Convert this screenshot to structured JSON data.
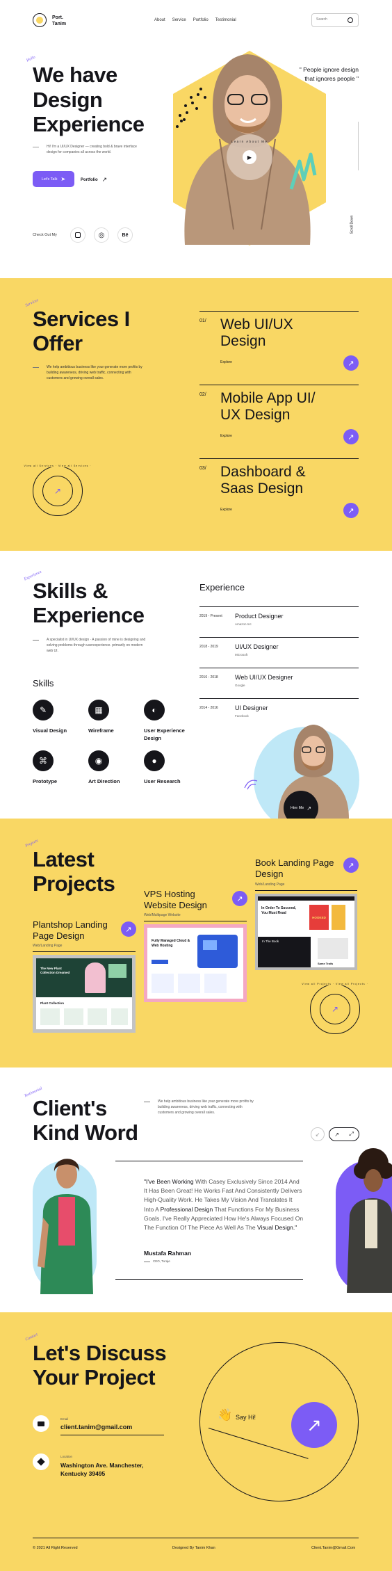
{
  "nav": {
    "brand_line1": "Port.",
    "brand_line2": "Tanim",
    "links": [
      "About",
      "Service",
      "Portfolio",
      "Testimonial"
    ],
    "search_placeholder": "Search"
  },
  "hero": {
    "title_line1": "We have",
    "title_line2": "Design",
    "title_line3": "Experience",
    "desc": "Hi! I'm a UI/UX Designer — creating bold & brave interface design for companies all across the world.",
    "lets_talk": "Let's Talk",
    "portfolio": "Portfolio",
    "quote_line1": "\" People ignore design",
    "quote_line2": "that ignores people \"",
    "badge_text": "Learn About Me",
    "check_out": "Check Out My",
    "social": [
      "instagram-icon",
      "dribbble-icon",
      "behance-icon"
    ],
    "behance_label": "Bē",
    "vertical_label": "Scroll Down"
  },
  "services": {
    "tag": "Services",
    "title_line1": "Services I",
    "title_line2": "Offer",
    "desc": "We help ambitious business like your generate more profits by building awareness, driving web traffic, connecting with customers and growing overall sales.",
    "badge": "View all Services · View all Services ·",
    "items": [
      {
        "num": "01/",
        "line1": "Web UI/UX",
        "line2": "Design",
        "explore": "Explore"
      },
      {
        "num": "02/",
        "line1": "Mobile App UI/",
        "line2": "UX Design",
        "explore": "Explore"
      },
      {
        "num": "03/",
        "line1": "Dashboard &",
        "line2": "Saas Design",
        "explore": "Explore"
      }
    ]
  },
  "skills": {
    "tag": "Experience",
    "title_line1": "Skills &",
    "title_line2": "Experience",
    "desc": "A specialist in UI/UX design  ·  A passion of mine is designing and solving problems through userexperience.  primarily on modern web UI.",
    "skills_heading": "Skills",
    "items": [
      {
        "label": "Visual Design",
        "icon": "pen-tool-icon",
        "glyph": "✎"
      },
      {
        "label": "Wireframe",
        "icon": "wireframe-icon",
        "glyph": "▦"
      },
      {
        "label": "User Experience",
        "label2": "Design",
        "icon": "ux-icon",
        "glyph": "◐"
      },
      {
        "label": "Prototype",
        "icon": "prototype-icon",
        "glyph": "⌘"
      },
      {
        "label": "Art Direction",
        "icon": "art-direction-icon",
        "glyph": "◉"
      },
      {
        "label": "User Research",
        "icon": "user-icon",
        "glyph": "●"
      }
    ],
    "experience_heading": "Experience",
    "experience": [
      {
        "date": "2019 - Present",
        "title": "Product Designer",
        "company": "Amazon Inc"
      },
      {
        "date": "2018 - 2019",
        "title": "UI/UX Designer",
        "company": "Microsoft"
      },
      {
        "date": "2016 - 2018",
        "title": "Web UI/UX Designer",
        "company": "Google"
      },
      {
        "date": "2014 - 2016",
        "title": "UI Designer",
        "company": "Facebook"
      }
    ],
    "hire_me": "Hire Me"
  },
  "projects": {
    "tag": "Projects",
    "title_line1": "Latest",
    "title_line2": "Projects",
    "badge": "View all Projects · View all Projects ·",
    "items": [
      {
        "line1": "Plantshop Landing",
        "line2": "Page Design",
        "sub": "Web/Landing Page",
        "mock_title": "The New Plant Collection Dreamed",
        "mock_sub": "Plant Collection"
      },
      {
        "line1": "VPS Hosting",
        "line2": "Website Design",
        "sub": "Web/Multipage Website",
        "mock_title": "Fully Managed Cloud & Web Hosting"
      },
      {
        "line1": "Book Landing Page",
        "line2": "Design",
        "sub": "Web/Landing Page",
        "mock_title": "In Order To Succeed, You Must Read",
        "mock_book": "HOOKED",
        "mock_label": "In The Book",
        "mock_label2": "Same Trails"
      }
    ]
  },
  "testimonial": {
    "tag": "Testimonial",
    "title_line1": "Client's",
    "title_line2": "Kind Word",
    "desc": "We help ambitious business like your generate more profits by building awareness, driving web traffic, connecting with customers and growing overall sales.",
    "quote_start": "\"I've Been Working",
    "quote_body": " With Casey Exclusively Since 2014 And It Has Been Great! He Works Fast And Consistently Delivers High-Quality Work. He Takes My Vision And Translates It Into A ",
    "quote_bold": "Professional Design",
    "quote_mid": " That Functions For My Business Goals. I've Really Appreciated How He's Always Focused On The Function Of The Piece As Well As The ",
    "quote_bold2": "Visual Design.\"",
    "author": "Mustafa Rahman",
    "author_role": "CEO, Turaje"
  },
  "contact": {
    "tag": "Contact",
    "title_line1": "Let's Discuss",
    "title_line2": "Your Project",
    "email_label": "Email",
    "email": "client.tanim@gmail.com",
    "location_label": "Location",
    "location_line1": "Washington Ave. Manchester,",
    "location_line2": "Kentucky 39495",
    "say_hi": "Say Hi!"
  },
  "footer": {
    "left": "© 2021 All Right Reserved",
    "center": "Designed By Tanim Khan",
    "right": "Client.Tanim@Gmail.Com"
  },
  "colors": {
    "yellow": "#f9d764",
    "purple": "#7c5cf5",
    "dark": "#15151a",
    "light_blue": "#bfe8f7"
  }
}
